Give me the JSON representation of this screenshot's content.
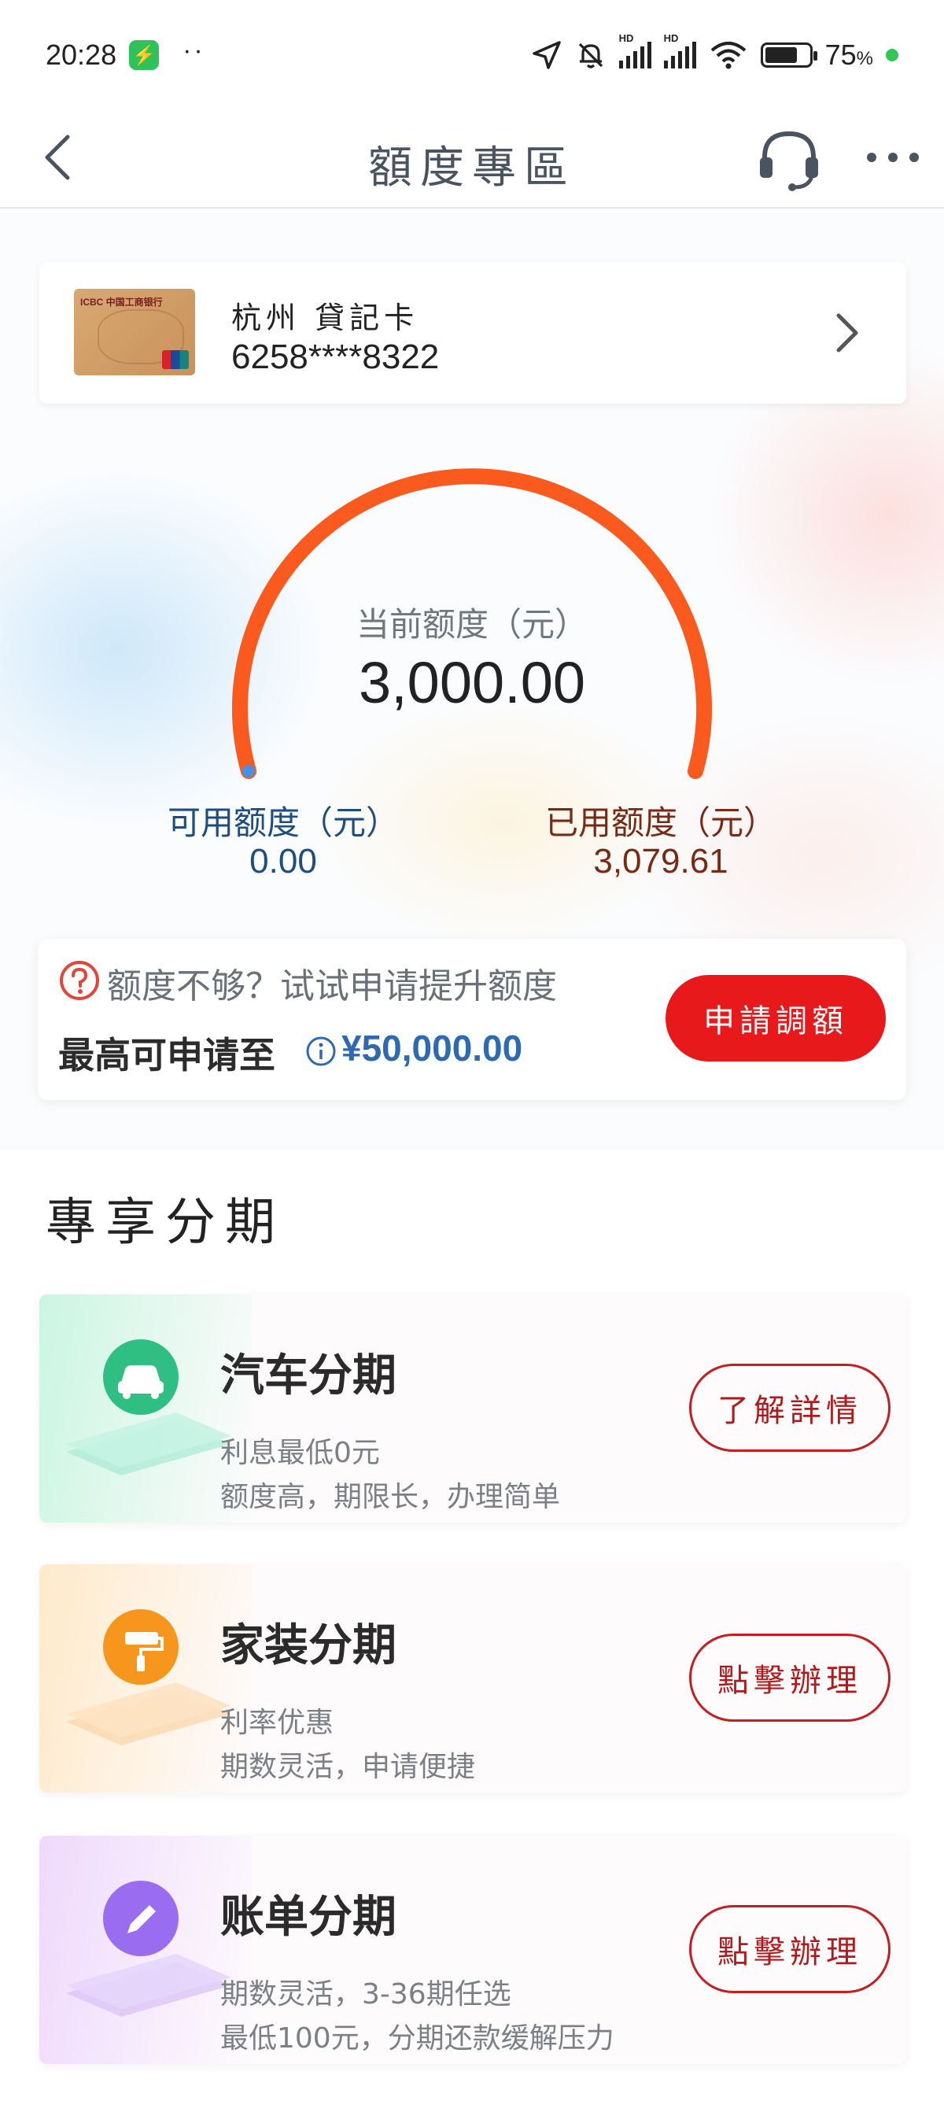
{
  "status_bar": {
    "time": "20:28",
    "battery_percent": "75",
    "battery_unit": "%"
  },
  "nav": {
    "title": "額度專區"
  },
  "card": {
    "name": "杭州 貸記卡",
    "number": "6258****8322"
  },
  "gauge": {
    "label": "当前额度（元）",
    "value": "3,000.00"
  },
  "available": {
    "label": "可用额度（元）",
    "value": "0.00"
  },
  "used": {
    "label": "已用额度（元）",
    "value": "3,079.61"
  },
  "raise": {
    "hint": "额度不够？试试申请提升额度",
    "max_label": "最高可申请至",
    "max_value": "¥50,000.00",
    "button": "申請調額"
  },
  "section": {
    "title": "專享分期"
  },
  "promos": [
    {
      "title": "汽车分期",
      "line1": "利息最低0元",
      "line2": "额度高，期限长，办理简单",
      "button": "了解詳情",
      "icon": "car-icon",
      "color": "#2fbf83"
    },
    {
      "title": "家装分期",
      "line1": "利率优惠",
      "line2": "期数灵活，申请便捷",
      "button": "點擊辦理",
      "icon": "paint-roller-icon",
      "color": "#f7961c"
    },
    {
      "title": "账单分期",
      "line1": "期数灵活，3-36期任选",
      "line2": "最低100元，分期还款缓解压力",
      "button": "點擊辦理",
      "icon": "pencil-icon",
      "color": "#9a6cf0"
    }
  ],
  "colors": {
    "accent_red": "#e8191b",
    "gauge_orange": "#fb5a1e",
    "available_blue": "#1e4d82",
    "used_brown": "#7a2a14"
  }
}
